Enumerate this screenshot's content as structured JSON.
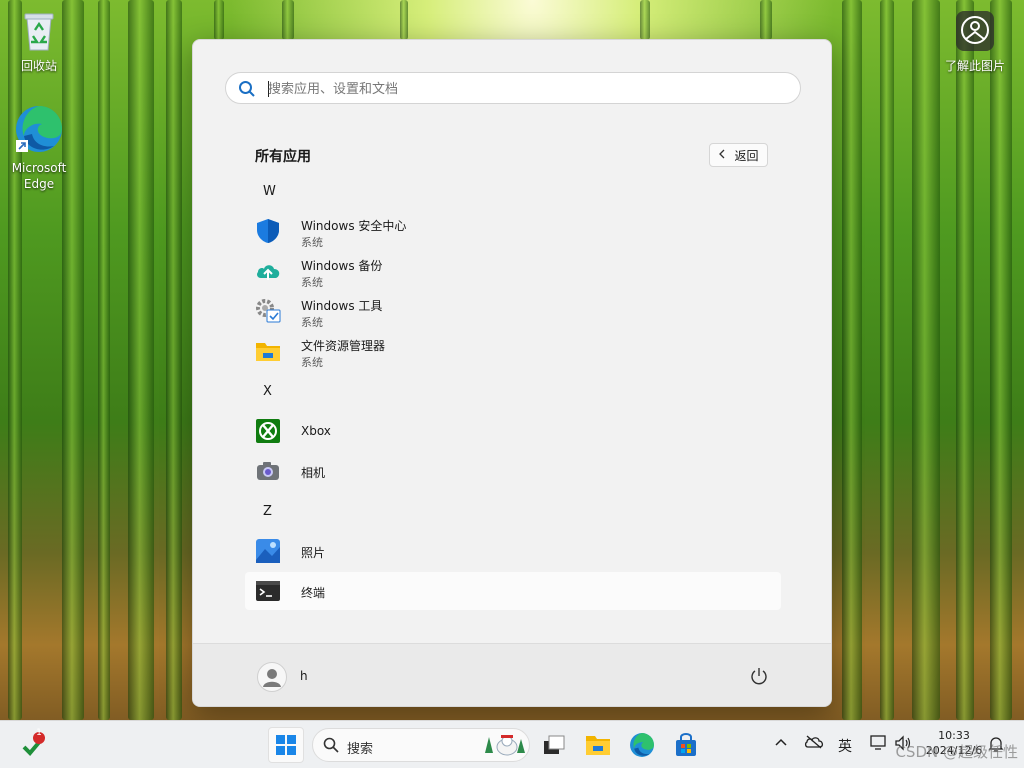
{
  "desktop": {
    "recycle_bin_label": "回收站",
    "edge_label_line1": "Microsoft",
    "edge_label_line2": "Edge",
    "learn_label": "了解此图片"
  },
  "start_menu": {
    "search_placeholder": "搜索应用、设置和文档",
    "title": "所有应用",
    "back_label": "返回",
    "sections": [
      {
        "letter": "W"
      },
      {
        "letter": "X"
      },
      {
        "letter": "Z"
      }
    ],
    "apps": [
      {
        "name": "Windows 安全中心",
        "category": "系统",
        "icon": "shield-icon"
      },
      {
        "name": "Windows 备份",
        "category": "系统",
        "icon": "cloud-backup-icon"
      },
      {
        "name": "Windows 工具",
        "category": "系统",
        "icon": "tools-gear-icon"
      },
      {
        "name": "文件资源管理器",
        "category": "系统",
        "icon": "folder-icon"
      },
      {
        "name": "Xbox",
        "icon": "xbox-icon"
      },
      {
        "name": "相机",
        "icon": "camera-icon"
      },
      {
        "name": "照片",
        "icon": "photos-icon"
      },
      {
        "name": "终端",
        "icon": "terminal-icon"
      }
    ],
    "user_name": "h"
  },
  "taskbar": {
    "search_label": "搜索",
    "badge_count": "1",
    "ime_label": "英",
    "time": "10:33",
    "date": "2024/12/6"
  },
  "watermark": "CSDN @超级任性"
}
